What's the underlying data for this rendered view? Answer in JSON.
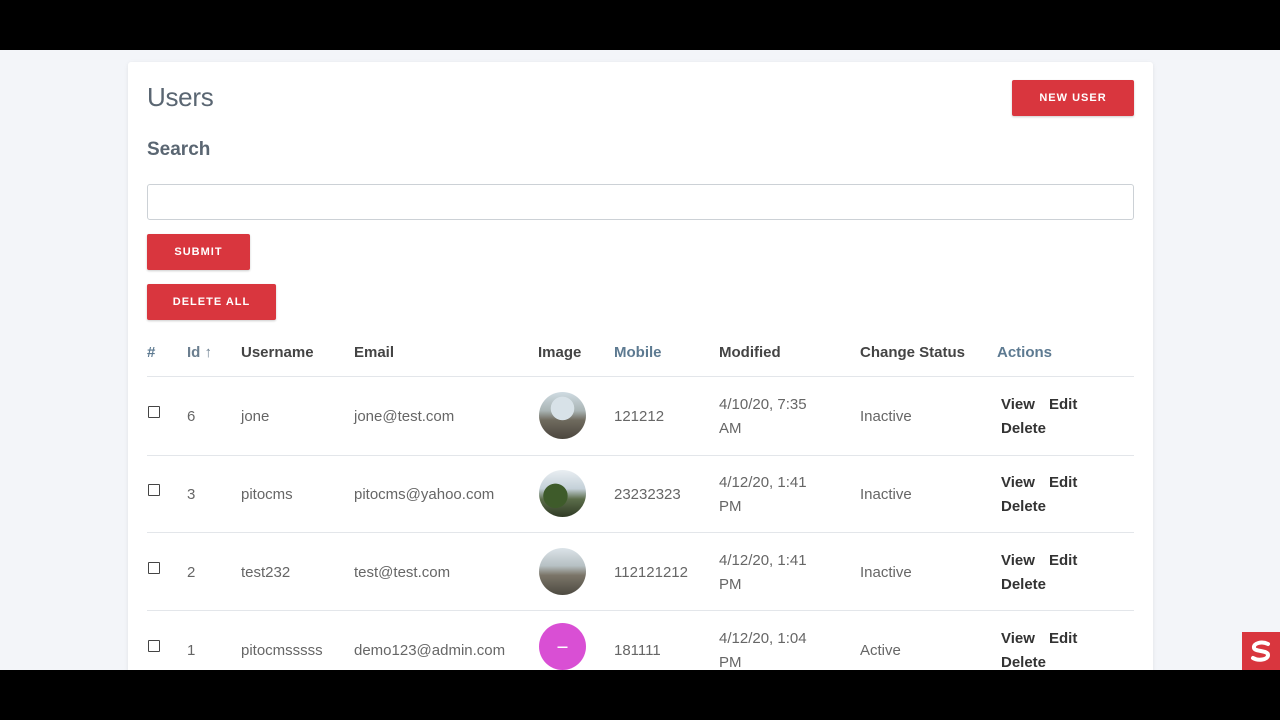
{
  "page": {
    "title": "Users",
    "new_user_label": "NEW USER",
    "search_label": "Search",
    "search_value": "",
    "submit_label": "SUBMIT",
    "delete_all_label": "DELETE ALL"
  },
  "table": {
    "headers": {
      "hash": "#",
      "id": "Id ↑",
      "username": "Username",
      "email": "Email",
      "image": "Image",
      "mobile": "Mobile",
      "modified": "Modified",
      "change_status": "Change Status",
      "actions": "Actions"
    },
    "rows": [
      {
        "id": "6",
        "username": "jone",
        "email": "jone@test.com",
        "mobile": "121212",
        "modified_l1": "4/10/20, 7:35",
        "modified_l2": "AM",
        "status": "Inactive",
        "view": "View",
        "edit": "Edit",
        "delete": "Delete",
        "image": "photo-landscape"
      },
      {
        "id": "3",
        "username": "pitocms",
        "email": "pitocms@yahoo.com",
        "mobile": "23232323",
        "modified_l1": "4/12/20, 1:41",
        "modified_l2": "PM",
        "status": "Inactive",
        "view": "View",
        "edit": "Edit",
        "delete": "Delete",
        "image": "photo-landscape"
      },
      {
        "id": "2",
        "username": "test232",
        "email": "test@test.com",
        "mobile": "112121212",
        "modified_l1": "4/12/20, 1:41",
        "modified_l2": "PM",
        "status": "Inactive",
        "view": "View",
        "edit": "Edit",
        "delete": "Delete",
        "image": "photo-landscape"
      },
      {
        "id": "1",
        "username": "pitocmsssss",
        "email": "demo123@admin.com",
        "mobile": "181111",
        "modified_l1": "4/12/20, 1:04",
        "modified_l2": "PM",
        "status": "Active",
        "view": "View",
        "edit": "Edit",
        "delete": "Delete",
        "image": "pink-logo"
      }
    ]
  },
  "colors": {
    "accent": "#d9363e",
    "background": "#f3f5f9",
    "title": "#5a6672"
  },
  "widget": {
    "icon": "brand-s-icon"
  }
}
